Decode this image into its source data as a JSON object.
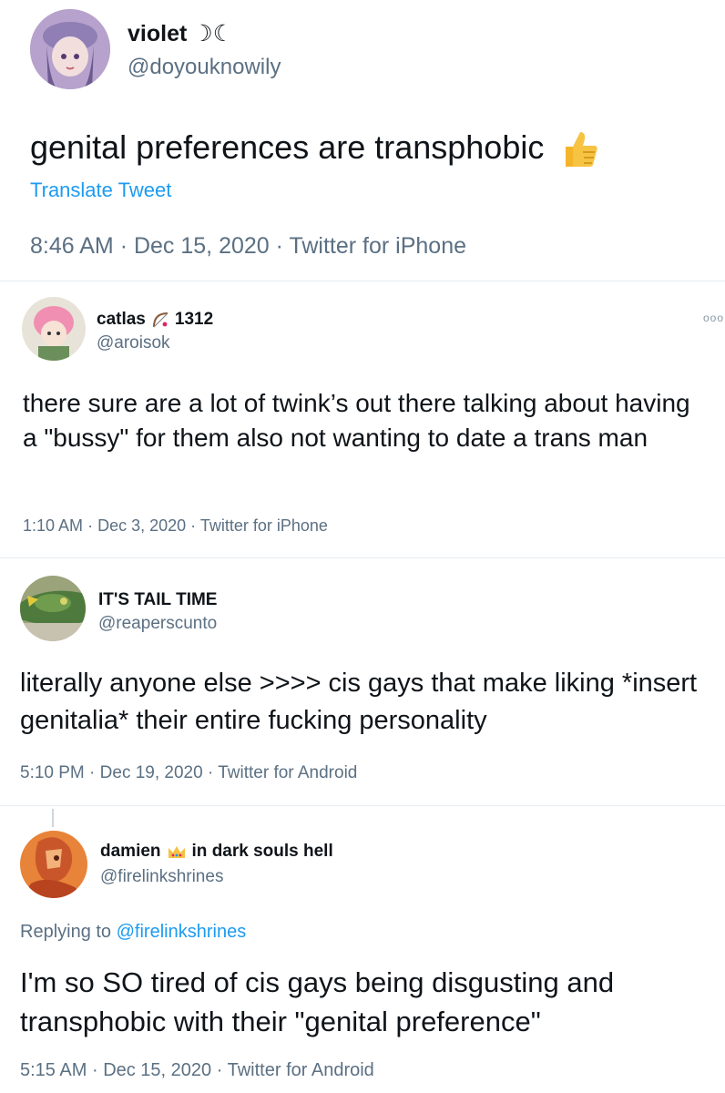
{
  "tweets": [
    {
      "display_name": "violet",
      "name_emoji": "☽☾",
      "handle": "@doyouknowily",
      "text": "genital preferences are transphobic",
      "text_emoji": "👍",
      "translate": "Translate Tweet",
      "time": "8:46 AM",
      "date": "Dec 15, 2020",
      "client": "Twitter for iPhone"
    },
    {
      "display_name": "catlas",
      "name_suffix": "1312",
      "handle": "@aroisok",
      "text": "there sure are a lot of twink’s out there talking about having a \"bussy\" for them also not wanting to date a trans man",
      "time": "1:10 AM",
      "date": "Dec 3, 2020",
      "client": "Twitter for iPhone",
      "more": "ooo"
    },
    {
      "display_name": "IT'S TAIL TIME",
      "handle": "@reaperscunto",
      "text": "literally anyone else >>>> cis gays that make liking *insert genitalia* their entire fucking personality",
      "time": "5:10 PM",
      "date": "Dec 19, 2020",
      "client": "Twitter for Android"
    },
    {
      "display_name": "damien",
      "name_suffix": "in dark souls hell",
      "handle": "@firelinkshrines",
      "replying_prefix": "Replying to",
      "replying_to": "@firelinkshrines",
      "text": "I'm so SO tired of cis gays being disgusting and transphobic with their \"genital preference\"",
      "time": "5:15 AM",
      "date": "Dec 15, 2020",
      "client": "Twitter for Android"
    }
  ],
  "separator": "·",
  "colors": {
    "text": "#0f1419",
    "secondary": "#5b7083",
    "link": "#1d9bf0",
    "divider": "#e6ecf0"
  }
}
